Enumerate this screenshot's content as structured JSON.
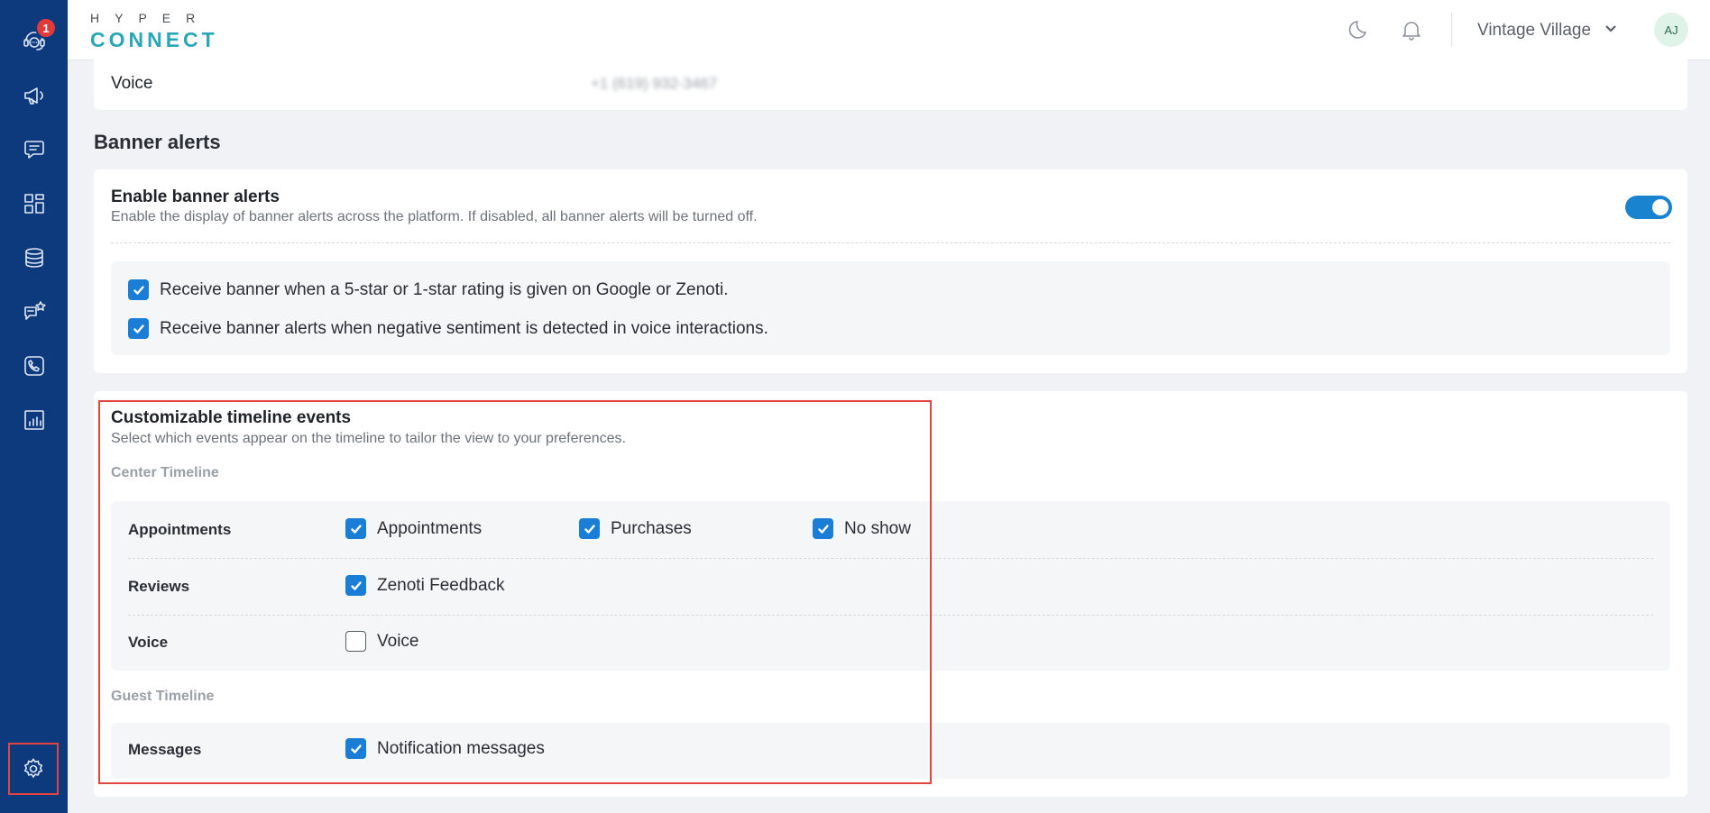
{
  "app": {
    "logo_top": "HYPER",
    "logo_bottom": "CONNECT",
    "notification_count": "1",
    "location": "Vintage Village",
    "avatar_initials": "AJ"
  },
  "sidebar": {
    "items": [
      {
        "icon": "headset-chat-icon"
      },
      {
        "icon": "megaphone-icon"
      },
      {
        "icon": "messages-icon"
      },
      {
        "icon": "dashboard-grid-icon"
      },
      {
        "icon": "database-icon"
      },
      {
        "icon": "reviews-star-icon"
      },
      {
        "icon": "phone-icon"
      },
      {
        "icon": "reports-chart-icon"
      },
      {
        "icon": "settings-gear-icon"
      }
    ]
  },
  "voice_row": {
    "label": "Voice",
    "value": "+1 (619) 932-3467"
  },
  "banner_alerts": {
    "section_title": "Banner alerts",
    "title": "Enable banner alerts",
    "description": "Enable the display of banner alerts across the platform. If disabled, all banner alerts will be turned off.",
    "enabled": true,
    "options": [
      {
        "label": "Receive banner when a 5-star or 1-star rating is given on Google or Zenoti.",
        "checked": true
      },
      {
        "label": "Receive banner alerts when negative sentiment is detected in voice interactions.",
        "checked": true
      }
    ]
  },
  "timeline": {
    "title": "Customizable timeline events",
    "description": "Select which events appear on the timeline to tailor the view to your preferences.",
    "center_heading": "Center Timeline",
    "guest_heading": "Guest Timeline",
    "rows": {
      "appointments": {
        "label": "Appointments",
        "options": [
          {
            "label": "Appointments",
            "checked": true
          },
          {
            "label": "Purchases",
            "checked": true
          },
          {
            "label": "No show",
            "checked": true
          }
        ]
      },
      "reviews": {
        "label": "Reviews",
        "options": [
          {
            "label": "Zenoti Feedback",
            "checked": true
          }
        ]
      },
      "voice": {
        "label": "Voice",
        "options": [
          {
            "label": "Voice",
            "checked": false
          }
        ]
      },
      "messages": {
        "label": "Messages",
        "options": [
          {
            "label": "Notification messages",
            "checked": true
          }
        ]
      }
    }
  },
  "colors": {
    "sidebar_bg": "#0d3a7d",
    "accent": "#1a7ed6",
    "highlight": "#e2453f",
    "badge": "#e23a3a"
  }
}
